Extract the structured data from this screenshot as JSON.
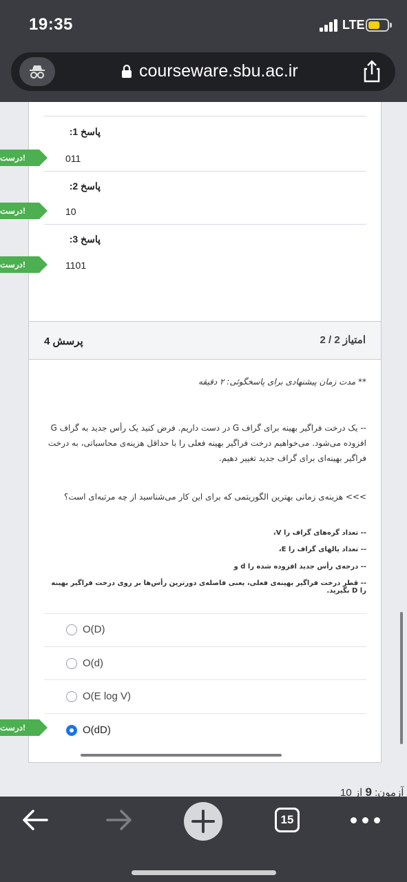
{
  "status_bar": {
    "time": "19:35",
    "network": "LTE"
  },
  "browser": {
    "url": "courseware.sbu.ac.ir",
    "tab_count": "15"
  },
  "answers": [
    {
      "label": "پاسخ 1:",
      "value": "011",
      "tag": "درست!"
    },
    {
      "label": "پاسخ 2:",
      "value": "10",
      "tag": "درست!"
    },
    {
      "label": "پاسخ 3:",
      "value": "1101",
      "tag": "درست!"
    }
  ],
  "question": {
    "title": "پرسش 4",
    "score": "امتیاز 2 / 2",
    "note": "** مدت زمان پیشنهادی برای پاسخگوئی: ۲ دقیقه",
    "para": "-- یک درخت فراگیر بهینه برای گراف G در دست داریم. فرض کنید یک رأس جدید به گراف G افزوده می‌شود. می‌خواهیم درخت فراگیر بهینه فعلی را با حداقل هزینه‌ی محاسباتی، به درخت فراگیر بهینه‌ای برای گراف جدید تغییر دهیم.",
    "ask": ">>> هزینه‌ی زمانی بهترین الگوریتمی که برای این کار می‌شناسید از چه مرتبه‌ای است؟",
    "defs": [
      "-- تعداد گره‌های گراف را V،",
      "-- تعداد یالهای گراف را E،",
      "-- درجه‌ی رأس جدید افزوده شده را d و",
      "-- قطر درخت فراگیر بهینه‌ی فعلی، یعنی فاصله‌ی دورترین رأس‌ها بر روی درخت فراگیر بهینه را D بگیرید."
    ],
    "options": [
      {
        "label": "O(D)",
        "checked": false
      },
      {
        "label": "O(d)",
        "checked": false
      },
      {
        "label": "O(E log V)",
        "checked": false
      },
      {
        "label": "O(dD)",
        "checked": true
      }
    ],
    "correct_tag": "درست!"
  },
  "quiz_progress": {
    "prefix": "آزمون:",
    "current": "9",
    "of": "از 10"
  }
}
